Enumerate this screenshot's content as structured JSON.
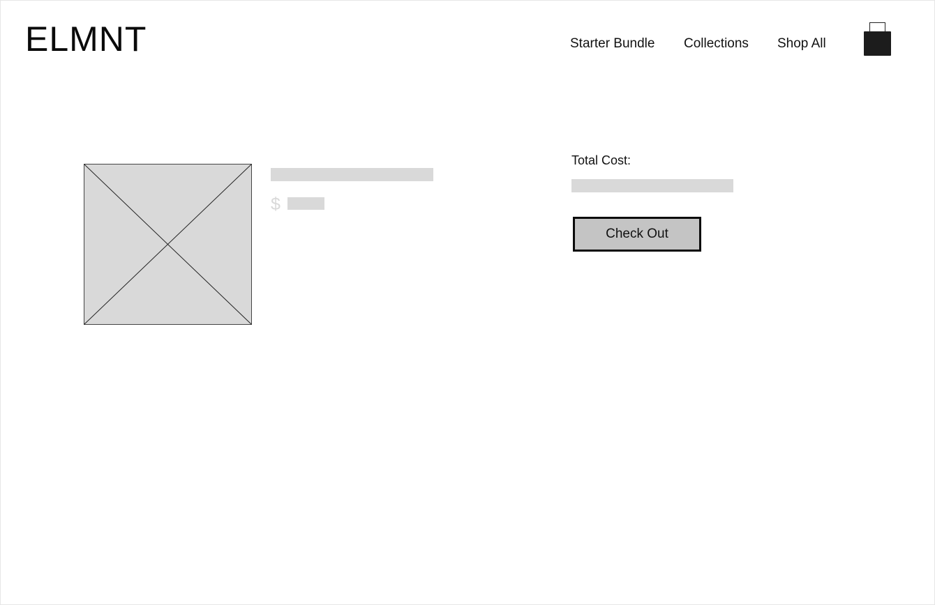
{
  "header": {
    "logo": "ELMNT",
    "nav": [
      {
        "label": "Starter Bundle"
      },
      {
        "label": "Collections"
      },
      {
        "label": "Shop All"
      }
    ],
    "cart_icon": "shopping-bag-icon"
  },
  "cart": {
    "item": {
      "image_placeholder": "image-placeholder-icon",
      "currency_symbol": "$"
    },
    "summary": {
      "total_label": "Total Cost:",
      "checkout_label": "Check Out"
    }
  },
  "colors": {
    "placeholder": "#d9d9d9",
    "button_fill": "#c4c4c4",
    "button_border": "#0b0b0b",
    "bag": "#1c1c1c",
    "text": "#111111"
  }
}
